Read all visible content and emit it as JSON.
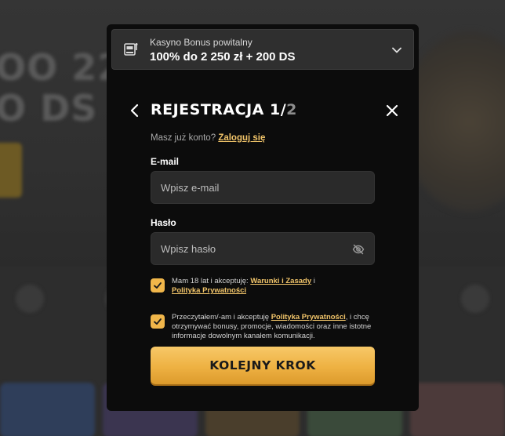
{
  "background": {
    "hero_text_lines": [
      "OO 22",
      "O DS"
    ],
    "accent_color": "#f0b64a"
  },
  "bonus": {
    "title": "Kasyno Bonus powitalny",
    "value": "100% do 2 250 zł + 200 DS",
    "icon": "slot-machine-icon"
  },
  "registration": {
    "title_main": "REJESTRACJA 1/",
    "title_total": "2",
    "login_prompt": "Masz już konto?",
    "login_link": "Zaloguj się",
    "email_label": "E-mail",
    "email_placeholder": "Wpisz e-mail",
    "password_label": "Hasło",
    "password_placeholder": "Wpisz hasło",
    "consent_1": {
      "checked": true,
      "text_before": "Mam 18 lat i akceptuję:",
      "link_terms": "Warunki i Zasady",
      "text_mid": "i",
      "link_privacy": "Polityka Prywatności"
    },
    "consent_2": {
      "checked": true,
      "text_before": "Przeczytałem/-am i akceptuję",
      "link_privacy": "Polityka Prywatności",
      "text_after": ", i chcę otrzymywać bonusy, promocje, wiadomości oraz inne istotne informacje dowolnym kanałem komunikacji."
    },
    "submit_label": "KOLEJNY KROK"
  }
}
